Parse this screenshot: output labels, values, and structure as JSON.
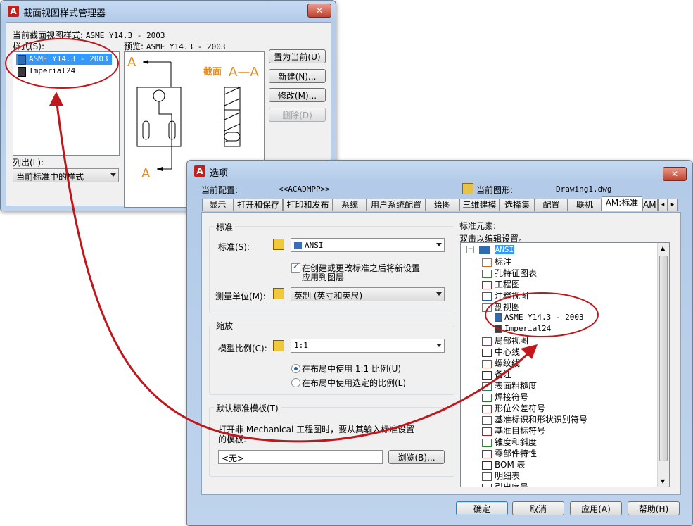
{
  "manager": {
    "title": "截面视图样式管理器",
    "close": "✕",
    "current_style_label": "当前截面视图样式:",
    "current_style_value": "ASME Y14.3 - 2003",
    "styles_label": "样式(S):",
    "styles": [
      "ASME Y14.3 - 2003",
      "Imperial24"
    ],
    "preview_label": "预览:",
    "preview_value": "ASME Y14.3 - 2003",
    "preview_text_a": "A",
    "preview_text_section": "截面",
    "preview_text_aa": "A—A",
    "buttons": {
      "set_current": "置为当前(U)",
      "new": "新建(N)...",
      "modify": "修改(M)...",
      "delete": "删除(D)"
    },
    "list_label": "列出(L):",
    "list_value": "当前标准中的样式"
  },
  "options": {
    "title": "选项",
    "close": "✕",
    "current_profile_label": "当前配置:",
    "current_profile_value": "<<ACADMPP>>",
    "current_drawing_label": "当前图形:",
    "current_drawing_value": "Drawing1.dwg",
    "tabs": [
      "显示",
      "打开和保存",
      "打印和发布",
      "系统",
      "用户系统配置",
      "绘图",
      "三维建模",
      "选择集",
      "配置",
      "联机",
      "AM:标准",
      "AM:"
    ],
    "standard_group": {
      "title": "标准",
      "standard_label": "标准(S):",
      "standard_value": "ANSI",
      "checkbox_label_line1": "在创建或更改标准之后将新设置",
      "checkbox_label_line2": "应用到图层",
      "units_label": "测量单位(M):",
      "units_value": "英制 (英寸和英尺)"
    },
    "scale_group": {
      "title": "缩放",
      "model_scale_label": "模型比例(C):",
      "model_scale_value": "1:1",
      "radio1": "在布局中使用 1:1 比例(U)",
      "radio2": "在布局中使用选定的比例(L)"
    },
    "template_group": {
      "title": "默认标准模板(T)",
      "desc_line1": "打开非 Mechanical 工程图时，要从其输入标准设置",
      "desc_line2": "的模板:",
      "template_value": "<无>",
      "browse": "浏览(B)..."
    },
    "elements_label": "标准元素:",
    "elements_hint": "双击以编辑设置。",
    "tree": {
      "root": "ANSI",
      "items": [
        "标注",
        "孔特征图表",
        "工程图",
        "注释视图",
        "剖视图",
        "局部视图",
        "中心线",
        "螺纹线",
        "备注",
        "表面粗糙度",
        "焊接符号",
        "形位公差符号",
        "基准标识和形状识别符号",
        "基准目标符号",
        "锥度和斜度",
        "零部件特性",
        "BOM 表",
        "明细表",
        "引出序号"
      ],
      "section_children": [
        "ASME Y14.3 - 2003",
        "Imperial24"
      ]
    },
    "footer": {
      "ok": "确定",
      "cancel": "取消",
      "apply": "应用(A)",
      "help": "帮助(H)"
    }
  },
  "colors": {
    "annotation": "#c0161c",
    "highlight": "#3399ff",
    "preview_orange": "#e88a1a"
  }
}
